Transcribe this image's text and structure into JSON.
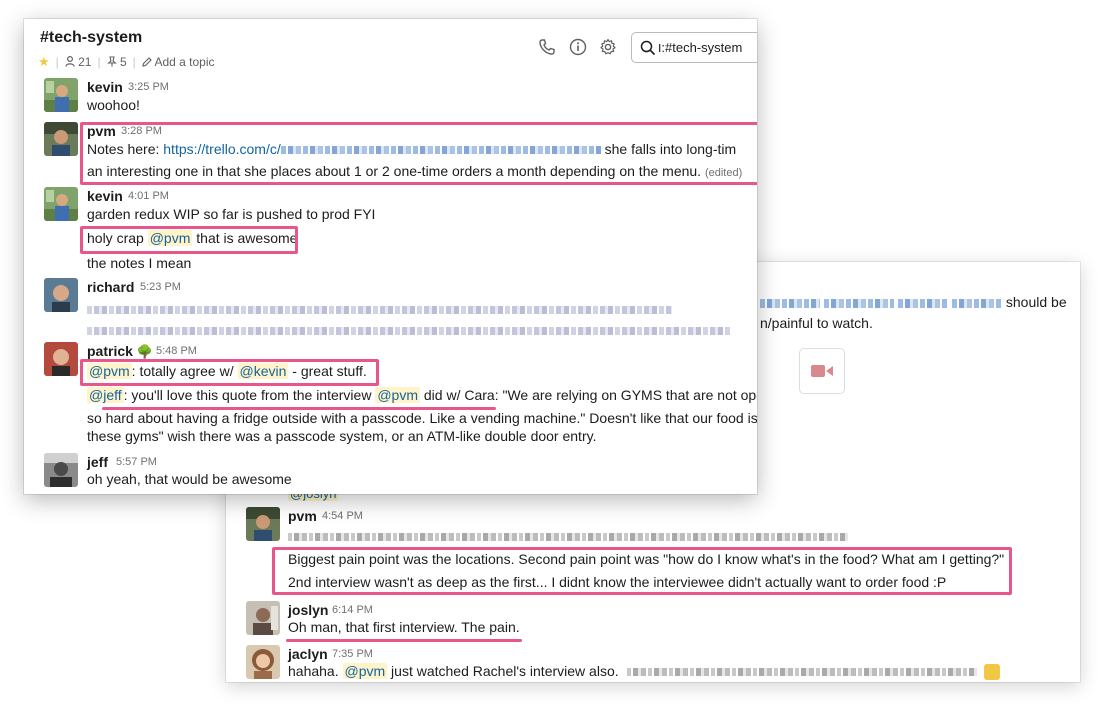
{
  "front": {
    "channel_name": "#tech-system",
    "members_count": "21",
    "pins_count": "5",
    "add_topic": "Add a topic",
    "search_value": "ו:#tech-system",
    "messages": {
      "kevin1": {
        "user": "kevin",
        "time": "3:25 PM",
        "text": "woohoo!"
      },
      "pvm1": {
        "user": "pvm",
        "time": "3:28 PM",
        "line1_prefix": "Notes here: ",
        "line1_link": "https://trello.com/c/",
        "line1_suffix": " she falls into long-tim",
        "line2": "an interesting one in that she places about 1 or 2 one-time orders a month depending on the menu.",
        "edited": "(edited)"
      },
      "kevin2": {
        "user": "kevin",
        "time": "4:01 PM",
        "line1": "garden redux WIP so far is pushed to prod FYI",
        "line2_prefix": "holy crap ",
        "line2_mention": "@pvm",
        "line2_suffix": " that is awesome",
        "line3": "the notes I mean"
      },
      "richard": {
        "user": "richard",
        "time": "5:23 PM"
      },
      "patrick": {
        "user": "patrick",
        "time": "5:48 PM",
        "l1_m1": "@pvm",
        "l1_t1": ": totally agree w/ ",
        "l1_m2": "@kevin",
        "l1_t2": " - great stuff.",
        "l2_m1": "@jeff",
        "l2_t1": ": you'll love this quote from the interview ",
        "l2_m2": "@pvm",
        "l2_t2": " did w/ Cara: \"We are relying on GYMS that are not ope",
        "l3": "so hard about having a fridge outside with a passcode. Like a vending machine.\" Doesn't like that our food is \"h",
        "l4": "these gyms\" wish there was a passcode system, or an ATM-like double door entry."
      },
      "jeff": {
        "user": "jeff",
        "time": "5:57 PM",
        "text": "oh yeah, that would be awesome"
      }
    }
  },
  "back": {
    "top_line1_suffix": " should be",
    "top_line2": "n/painful to watch.",
    "partial_mention": "@joslyn",
    "messages": {
      "pvm": {
        "user": "pvm",
        "time": "4:54 PM",
        "line2": "Biggest pain point was the locations. Second pain point was \"how do I know what's in the food? What am I getting?\"",
        "line3": "2nd interview wasn't as deep as the first... I didnt know the interviewee didn't actually want to order food :P"
      },
      "joslyn": {
        "user": "joslyn",
        "time": "6:14 PM",
        "text": "Oh man, that first interview. The pain."
      },
      "jaclyn": {
        "user": "jaclyn",
        "time": "7:35 PM",
        "prefix": "hahaha. ",
        "mention": "@pvm",
        "suffix": " just watched Rachel's interview also."
      }
    }
  },
  "colors": {
    "highlight": "#e8578b",
    "link": "#1264a3",
    "mention_bg": "#fff3c7"
  },
  "icons": [
    "star-icon",
    "members-icon",
    "pin-icon",
    "pencil-icon",
    "phone-icon",
    "info-icon",
    "gear-icon",
    "search-icon",
    "video-icon",
    "leaf-emoji-icon"
  ]
}
